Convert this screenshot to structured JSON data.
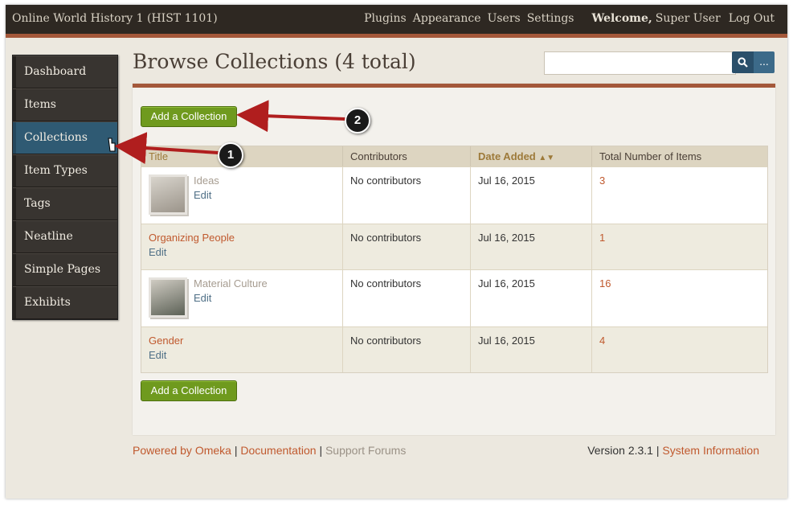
{
  "header": {
    "site_title": "Online World History 1 (HIST 1101)",
    "nav": [
      "Plugins",
      "Appearance",
      "Users",
      "Settings"
    ],
    "welcome": "Welcome,",
    "user_name": "Super User",
    "logout": "Log Out"
  },
  "sidebar": {
    "items": [
      {
        "label": "Dashboard"
      },
      {
        "label": "Items"
      },
      {
        "label": "Collections"
      },
      {
        "label": "Item Types"
      },
      {
        "label": "Tags"
      },
      {
        "label": "Neatline"
      },
      {
        "label": "Simple Pages"
      },
      {
        "label": "Exhibits"
      }
    ],
    "active": "Collections"
  },
  "main": {
    "title": "Browse Collections (4 total)",
    "search_placeholder": "",
    "search_icon": "search-icon",
    "more_label": "...",
    "add_button": "Add a Collection",
    "columns": [
      "Title",
      "Contributors",
      "Date Added",
      "Total Number of Items"
    ],
    "rows": [
      {
        "title": "Ideas",
        "edit": "Edit",
        "contributors": "No contributors",
        "date": "Jul 16, 2015",
        "count": "3",
        "thumb": true
      },
      {
        "title": "Organizing People",
        "edit": "Edit",
        "contributors": "No contributors",
        "date": "Jul 16, 2015",
        "count": "1",
        "thumb": false
      },
      {
        "title": "Material Culture",
        "edit": "Edit",
        "contributors": "No contributors",
        "date": "Jul 16, 2015",
        "count": "16",
        "thumb": true
      },
      {
        "title": "Gender",
        "edit": "Edit",
        "contributors": "No contributors",
        "date": "Jul 16, 2015",
        "count": "4",
        "thumb": false
      }
    ]
  },
  "footer": {
    "powered": "Powered by Omeka",
    "sep": "|",
    "documentation": "Documentation",
    "support": "Support Forums",
    "version": "Version 2.3.1",
    "system_info": "System Information"
  },
  "callouts": {
    "one": "1",
    "two": "2"
  },
  "colors": {
    "accent": "#a4583a",
    "active": "#2f5a73",
    "button": "#6f9a1e",
    "link": "#c0592e",
    "arrow": "#b01e1e"
  }
}
